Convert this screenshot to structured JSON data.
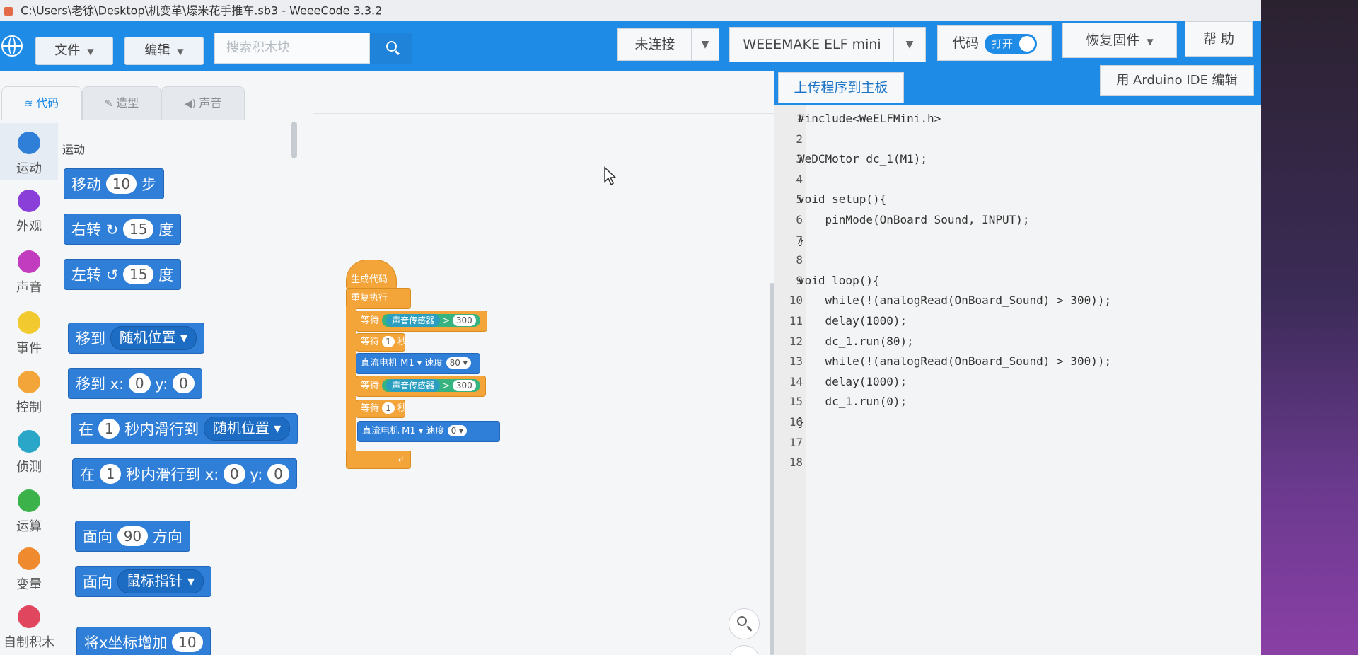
{
  "window": {
    "title": "C:\\Users\\老徐\\Desktop\\机变革\\爆米花手推车.sb3 - WeeeCode 3.3.2"
  },
  "toolbar": {
    "file_label": "文件",
    "edit_label": "编辑",
    "search_placeholder": "搜索积木块",
    "connection_label": "未连接",
    "device_label": "WEEEMAKE ELF mini",
    "code_label": "代码",
    "code_toggle_label": "打开",
    "firmware_label": "恢复固件",
    "help_label": "帮 助"
  },
  "codebar": {
    "upload_label": "上传程序到主板",
    "arduino_label": "用 Arduino IDE 编辑"
  },
  "tabs": [
    {
      "label": "代码"
    },
    {
      "label": "造型"
    },
    {
      "label": "声音"
    }
  ],
  "categories": [
    {
      "label": "运动",
      "color": "#2f7fd9"
    },
    {
      "label": "外观",
      "color": "#8a3fd9"
    },
    {
      "label": "声音",
      "color": "#c23cbf"
    },
    {
      "label": "事件",
      "color": "#f2c92e"
    },
    {
      "label": "控制",
      "color": "#f3a53a"
    },
    {
      "label": "侦测",
      "color": "#2aa7c8"
    },
    {
      "label": "运算",
      "color": "#3bb34a"
    },
    {
      "label": "变量",
      "color": "#f08a2e"
    },
    {
      "label": "自制积木",
      "color": "#e0475e"
    }
  ],
  "palette": {
    "heading": "运动",
    "move": {
      "a": "移动",
      "v": "10",
      "b": "步"
    },
    "turn_right": {
      "a": "右转",
      "icon": "↻",
      "v": "15",
      "b": "度"
    },
    "turn_left": {
      "a": "左转",
      "icon": "↺",
      "v": "15",
      "b": "度"
    },
    "goto": {
      "a": "移到",
      "dd": "随机位置 ▾"
    },
    "goto_xy": {
      "a": "移到 x:",
      "x": "0",
      "b": "y:",
      "y": "0"
    },
    "glide": {
      "a": "在",
      "v": "1",
      "b": "秒内滑行到",
      "dd": "随机位置 ▾"
    },
    "glide_xy": {
      "a": "在",
      "v": "1",
      "b": "秒内滑行到 x:",
      "x": "0",
      "c": "y:",
      "y": "0"
    },
    "point": {
      "a": "面向",
      "v": "90",
      "b": "方向"
    },
    "point_to": {
      "a": "面向",
      "dd": "鼠标指针 ▾"
    },
    "change_x": {
      "a": "将x坐标增加",
      "v": "10"
    }
  },
  "script": {
    "hat": "生成代码",
    "forever": "重复执行",
    "wait_until_1": {
      "a": "等待",
      "sensor": "声音传感器",
      "op": ">",
      "v": "300"
    },
    "wait_1": {
      "a": "等待",
      "v": "1",
      "b": "秒"
    },
    "motor_1": {
      "a": "直流电机",
      "port": "M1 ▾",
      "b": "速度",
      "v": "80 ▾"
    },
    "wait_until_2": {
      "a": "等待",
      "sensor": "声音传感器",
      "op": ">",
      "v": "300"
    },
    "wait_2": {
      "a": "等待",
      "v": "1",
      "b": "秒"
    },
    "motor_2": {
      "a": "直流电机",
      "port": "M1 ▾",
      "b": "速度",
      "v": "0 ▾"
    },
    "loop_arrow": "↲"
  },
  "code_lines": [
    "#include<WeELFMini.h>",
    "",
    "WeDCMotor dc_1(M1);",
    "",
    "void setup(){",
    "    pinMode(OnBoard_Sound, INPUT);",
    "}",
    "",
    "void loop(){",
    "    while(!(analogRead(OnBoard_Sound) > 300));",
    "    delay(1000);",
    "    dc_1.run(80);",
    "    while(!(analogRead(OnBoard_Sound) > 300));",
    "    delay(1000);",
    "    dc_1.run(0);",
    "}",
    "",
    ""
  ],
  "line_numbers": [
    "1",
    "2",
    "3",
    "4",
    "5",
    "6",
    "7",
    "8",
    "9",
    "10",
    "11",
    "12",
    "13",
    "14",
    "15",
    "16",
    "17",
    "18"
  ]
}
